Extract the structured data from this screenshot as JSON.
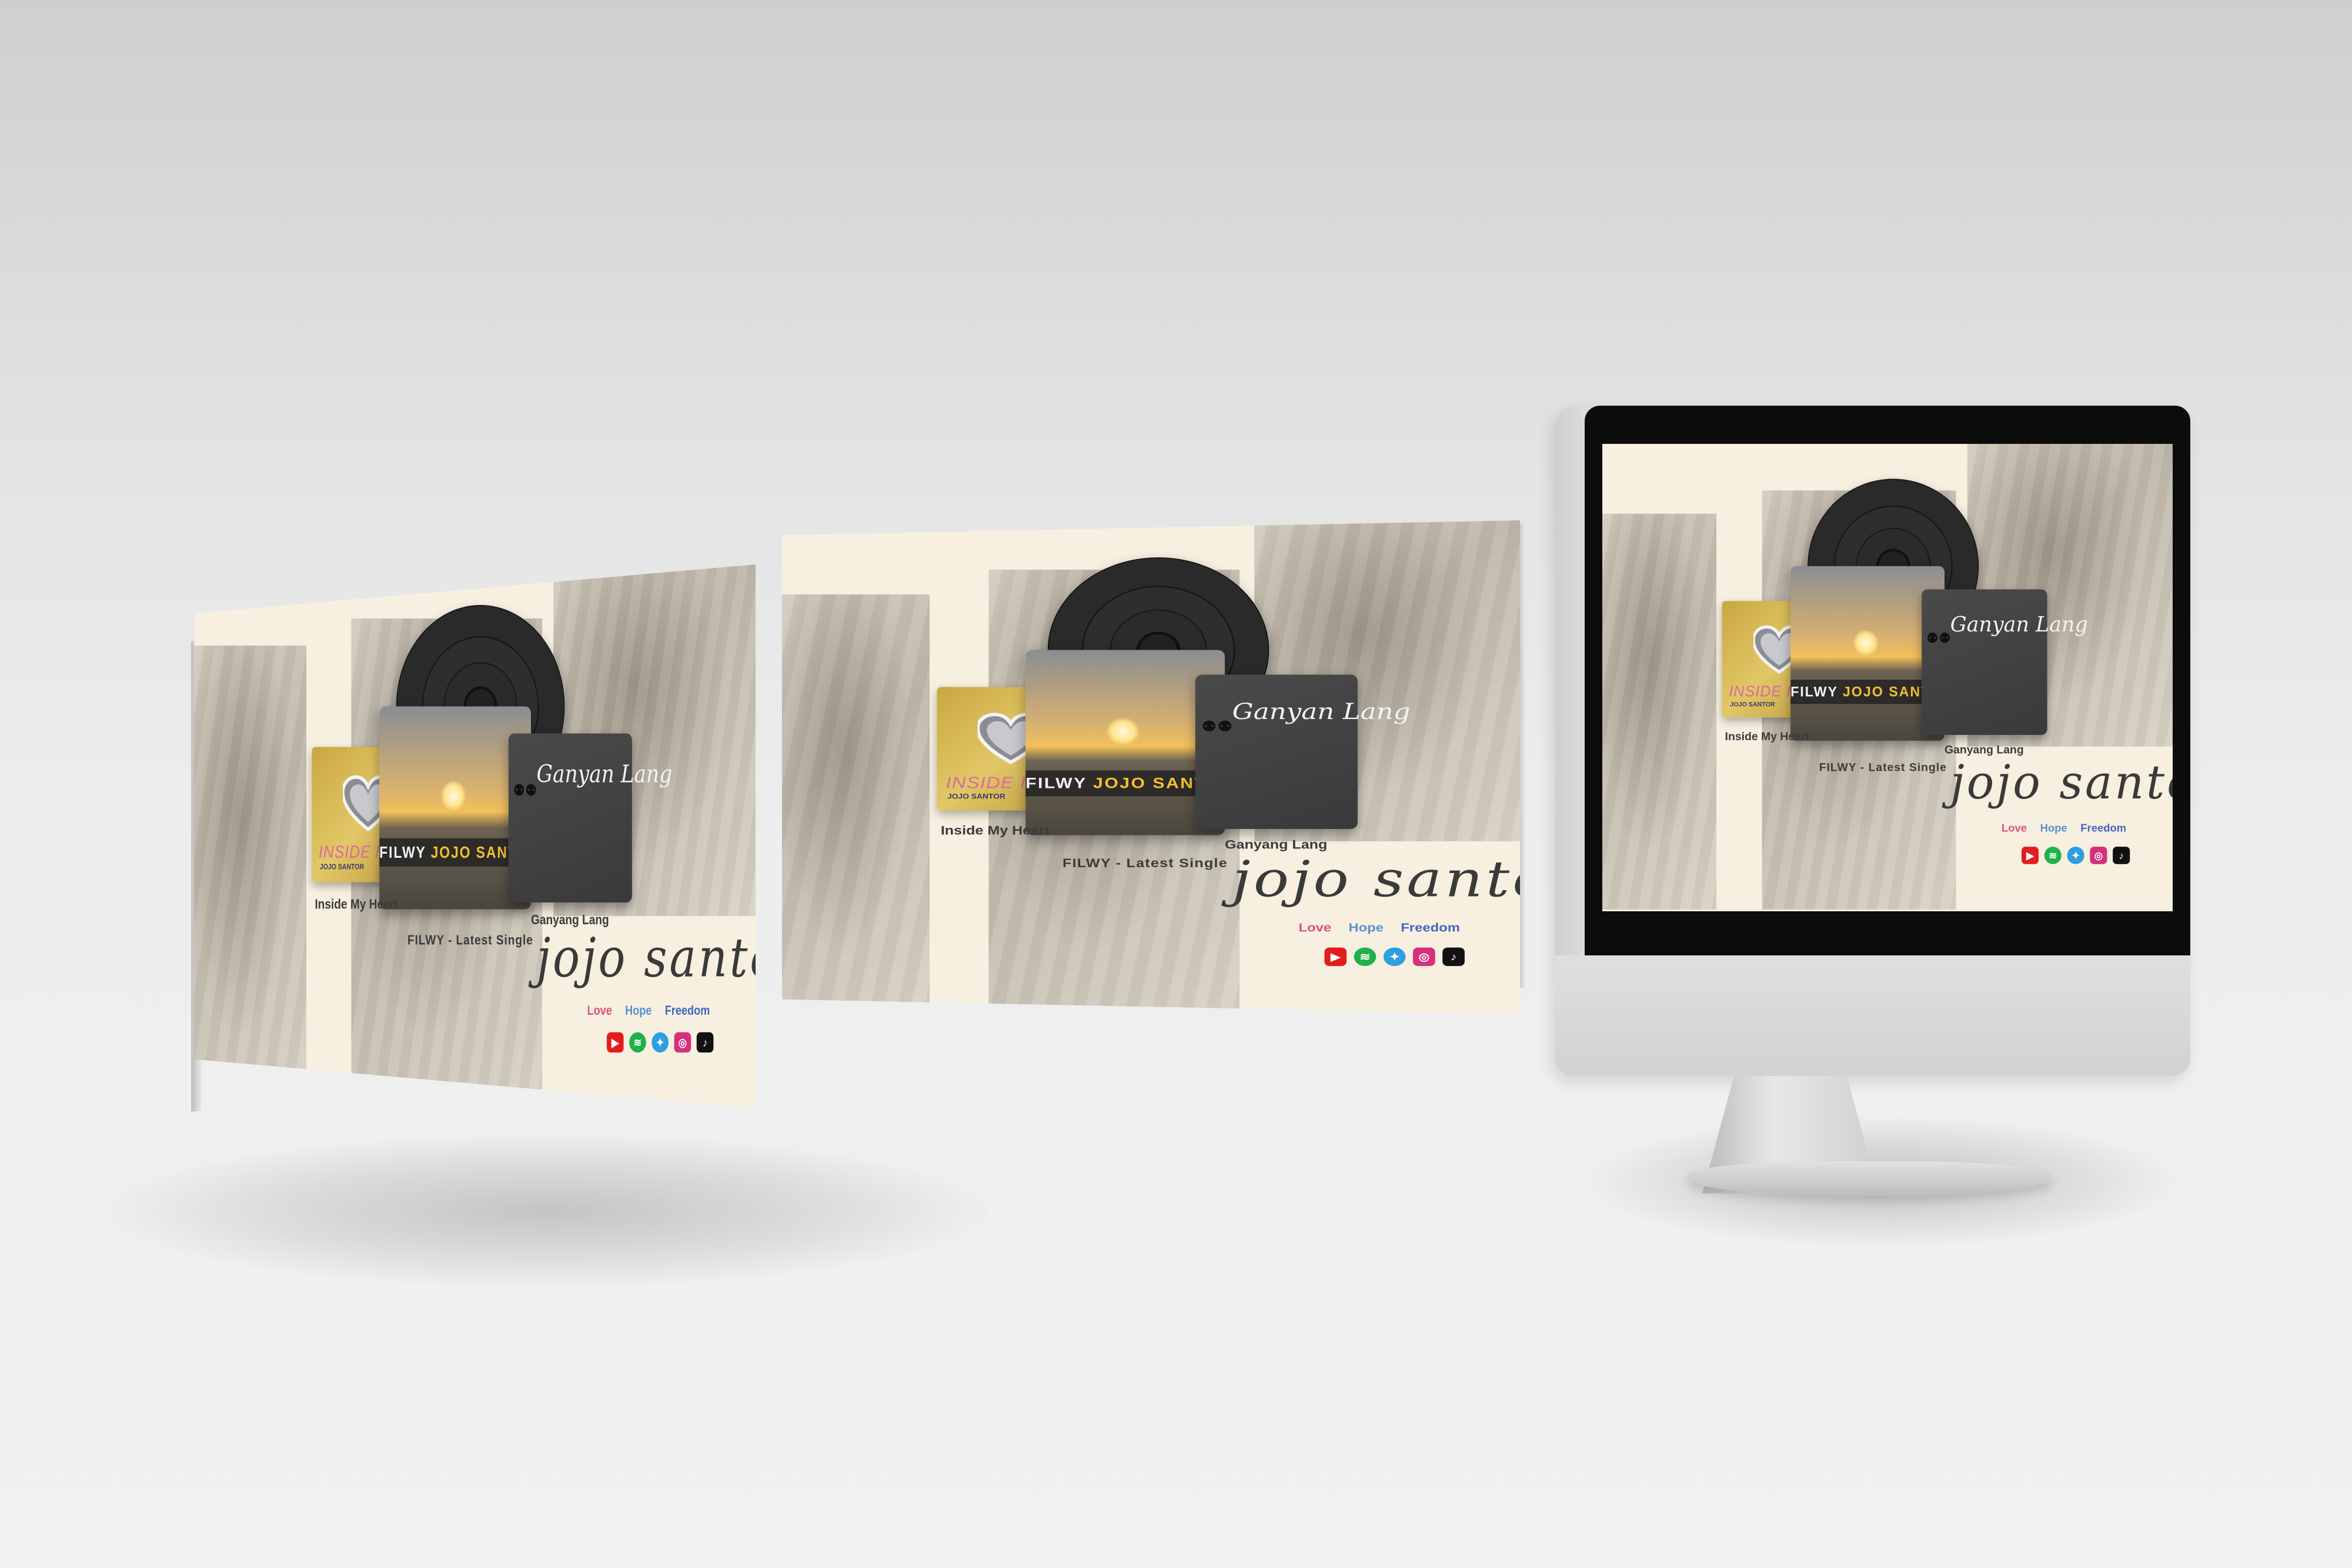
{
  "banner": {
    "card_heart_title": "INSIDE MY HEART",
    "card_heart_sub": "JOJO SANTOR",
    "sunset_word1": "FILWY",
    "sunset_word2": "JOJO SANTOR",
    "dark_card_title": "Ganyan Lang",
    "caption_heart": "Inside My Heart",
    "caption_filwy": "FILWY - Latest Single",
    "caption_ganyang": "Ganyang Lang",
    "brand": "jojo santor",
    "tags": [
      {
        "label": "Love",
        "color": "#e0527a"
      },
      {
        "label": "Hope",
        "color": "#5b8fd4"
      },
      {
        "label": "Freedom",
        "color": "#4366c4"
      }
    ],
    "social": [
      {
        "name": "youtube-icon",
        "glyph": "▶",
        "color": "#e31d1d"
      },
      {
        "name": "spotify-icon",
        "glyph": "≋",
        "color": "#21b04b"
      },
      {
        "name": "twitter-icon",
        "glyph": "✦",
        "color": "#2d9ee0"
      },
      {
        "name": "instagram-icon",
        "glyph": "◎",
        "color": "#d6307c"
      },
      {
        "name": "tiktok-icon",
        "glyph": "♪",
        "color": "#111111"
      }
    ]
  }
}
